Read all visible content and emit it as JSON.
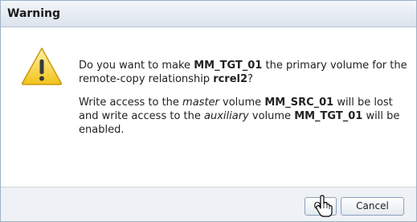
{
  "dialog": {
    "title": "Warning",
    "icon": "warning-icon",
    "message": {
      "p1": {
        "a": "Do you want to make ",
        "b": "MM_TGT_01",
        "c": " the primary volume for the remote-copy relationship ",
        "d": "rcrel2",
        "e": "?"
      },
      "p2": {
        "a": "Write access to the ",
        "b": "master",
        "c": " volume ",
        "d": "MM_SRC_01",
        "e": " will be lost and write access to the ",
        "f": "auxiliary",
        "g": " volume ",
        "h": "MM_TGT_01",
        "i": " will be enabled."
      }
    },
    "buttons": {
      "ok_label": "OK",
      "cancel_label": "Cancel"
    }
  },
  "colors": {
    "titlebar": "#dbe3ec",
    "border": "#9eb0c3",
    "warning_yellow": "#f2c21a",
    "footer": "#eef1f5"
  }
}
